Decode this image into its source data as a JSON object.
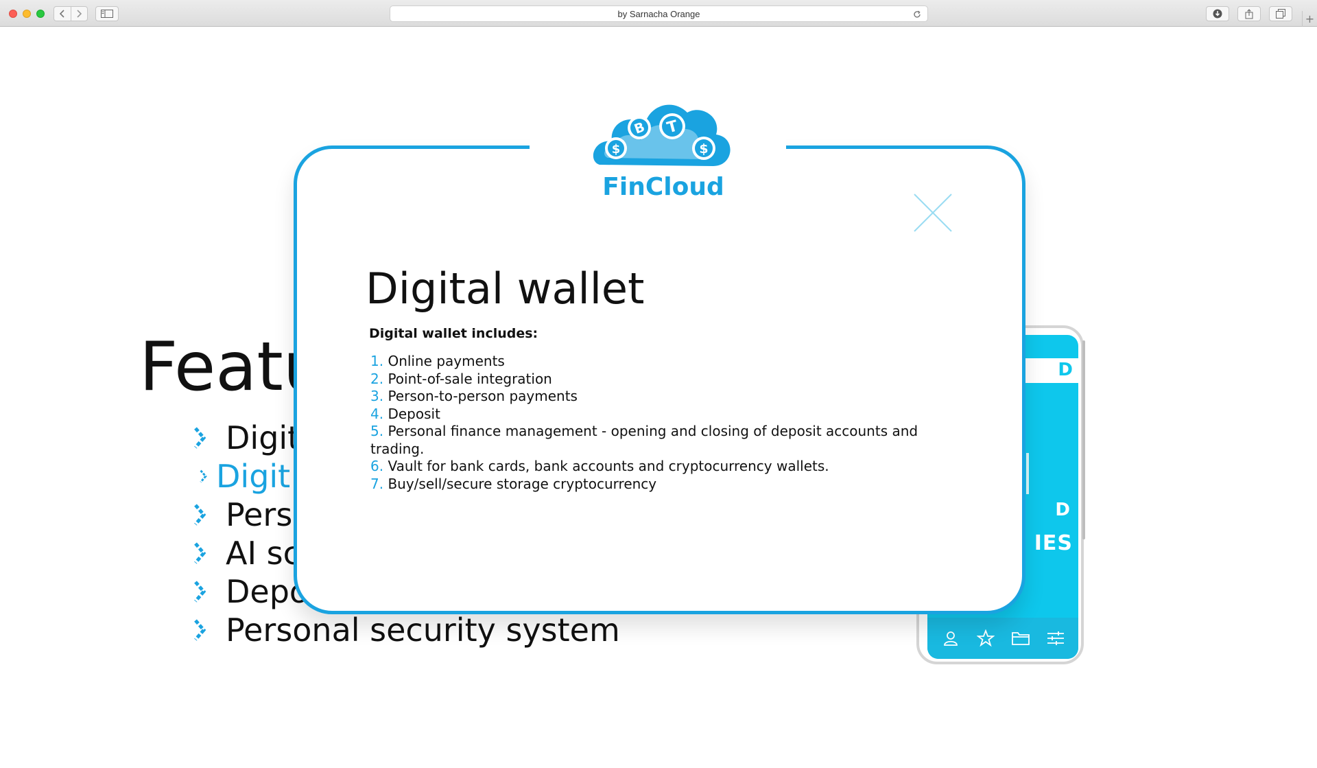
{
  "browser": {
    "url_text": "by Sarnacha Orange",
    "new_tab": "+"
  },
  "slide": {
    "title": "Featu",
    "items": [
      {
        "label": "Digit",
        "active": false
      },
      {
        "label": "Digit",
        "active": true
      },
      {
        "label": "Perso",
        "active": false
      },
      {
        "label": "AI sco",
        "active": false
      },
      {
        "label": "Depo",
        "active": false
      },
      {
        "label": "Personal security system",
        "active": false
      }
    ]
  },
  "phone": {
    "bar_letter": "D",
    "mid_letter": "D",
    "caption": "IES",
    "tabs": [
      "user-icon",
      "star-icon",
      "folder-icon",
      "sliders-icon"
    ]
  },
  "modal": {
    "logo_text": "FinCloud",
    "logo_letters": [
      "$",
      "B",
      "T",
      "$"
    ],
    "title": "Digital wallet",
    "subtitle": "Digital wallet includes:",
    "items": [
      {
        "num": "1.",
        "text": "Online payments"
      },
      {
        "num": "2.",
        "text": "Point-of-sale integration"
      },
      {
        "num": "3.",
        "text": "Person-to-person payments"
      },
      {
        "num": "4.",
        "text": " Deposit"
      },
      {
        "num": "5.",
        "text": " Personal finance management - opening and closing of deposit accounts and trading."
      },
      {
        "num": "6.",
        "text": " Vault for bank cards, bank accounts and cryptocurrency wallets."
      },
      {
        "num": "7.",
        "text": " Buy/sell/secure storage cryptocurrency"
      }
    ]
  },
  "colors": {
    "accent": "#1aa3e0",
    "phone_screen": "#0ec7ec"
  }
}
